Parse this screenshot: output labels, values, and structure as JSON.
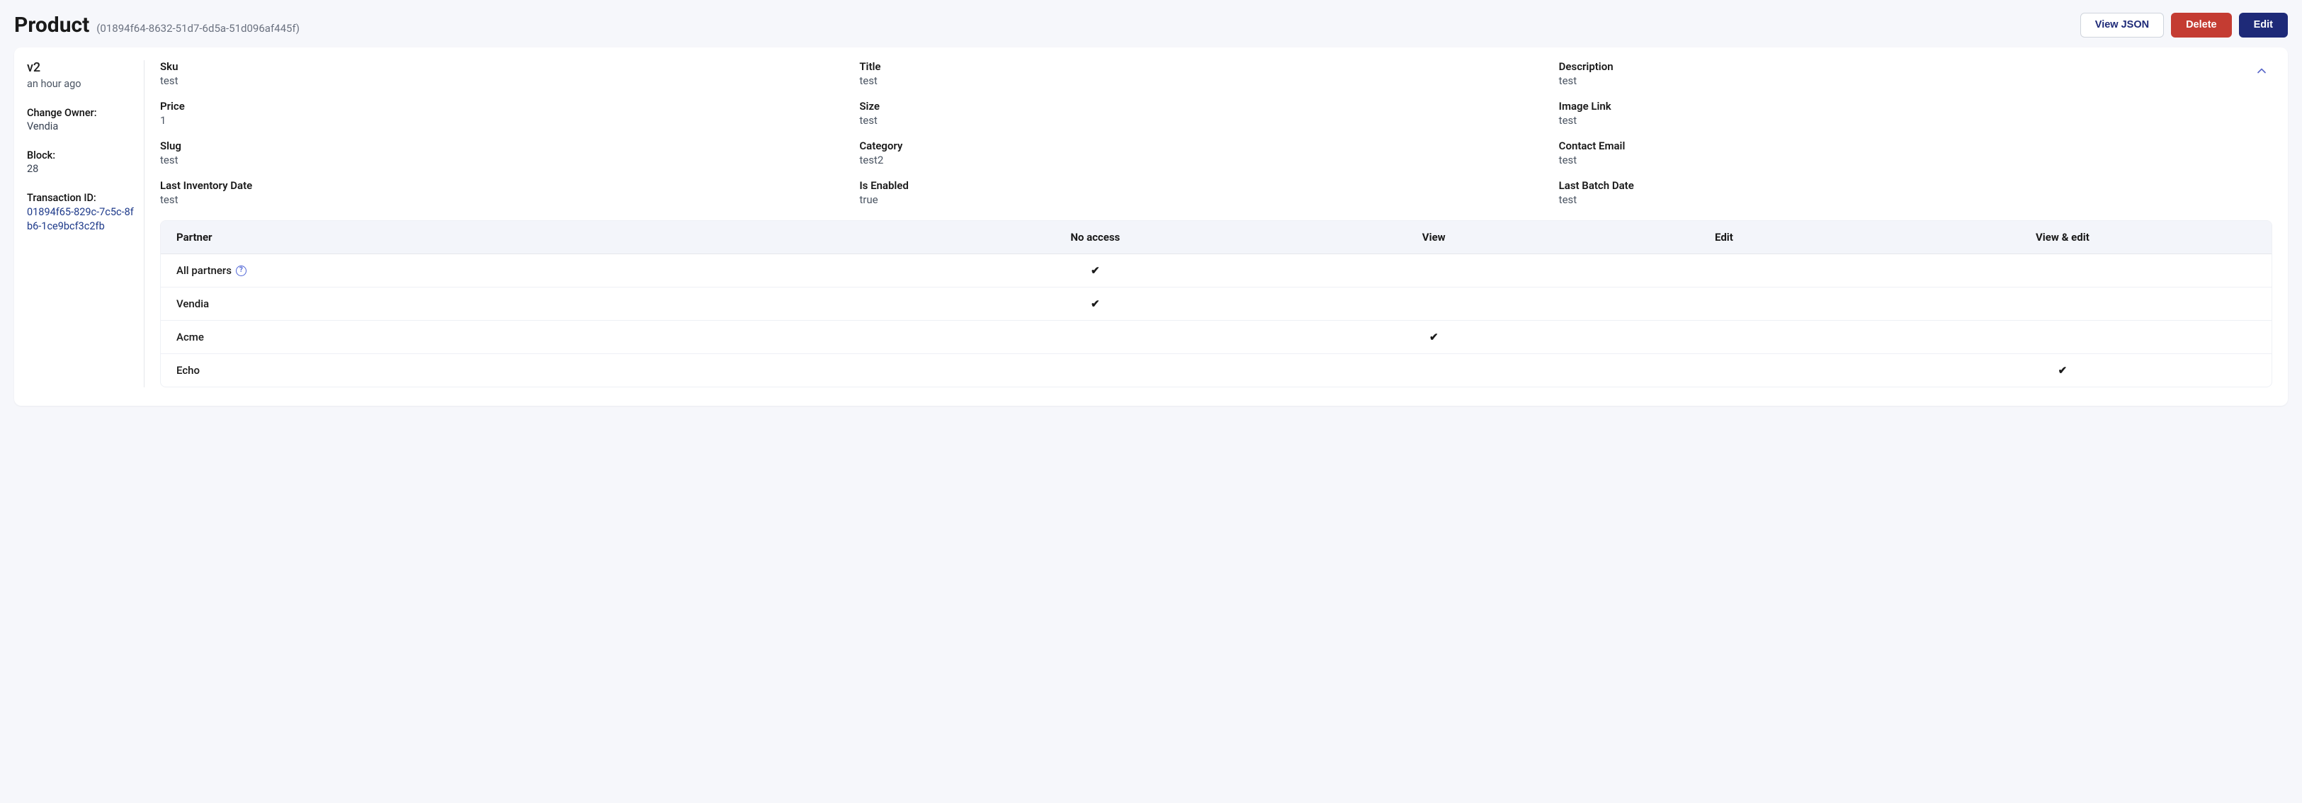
{
  "header": {
    "title": "Product",
    "id_display": "(01894f64-8632-51d7-6d5a-51d096af445f)",
    "actions": {
      "view_json": "View JSON",
      "delete": "Delete",
      "edit": "Edit"
    }
  },
  "meta": {
    "version": "v2",
    "time": "an hour ago",
    "change_owner_label": "Change Owner:",
    "change_owner_value": "Vendia",
    "block_label": "Block:",
    "block_value": "28",
    "txn_label": "Transaction ID:",
    "txn_value": "01894f65-829c-7c5c-8fb6-1ce9bcf3c2fb"
  },
  "fields": {
    "sku": {
      "label": "Sku",
      "value": "test"
    },
    "title": {
      "label": "Title",
      "value": "test"
    },
    "description": {
      "label": "Description",
      "value": "test"
    },
    "price": {
      "label": "Price",
      "value": "1"
    },
    "size": {
      "label": "Size",
      "value": "test"
    },
    "image_link": {
      "label": "Image Link",
      "value": "test"
    },
    "slug": {
      "label": "Slug",
      "value": "test"
    },
    "category": {
      "label": "Category",
      "value": "test2"
    },
    "contact_email": {
      "label": "Contact Email",
      "value": "test"
    },
    "last_inventory": {
      "label": "Last Inventory Date",
      "value": "test"
    },
    "is_enabled": {
      "label": "Is Enabled",
      "value": "true"
    },
    "last_batch": {
      "label": "Last Batch Date",
      "value": "test"
    }
  },
  "permissions": {
    "columns": {
      "partner": "Partner",
      "no_access": "No access",
      "view": "View",
      "edit": "Edit",
      "view_edit": "View & edit"
    },
    "rows": [
      {
        "partner": "All partners",
        "info": true,
        "no_access": "✔",
        "view": "",
        "edit": "",
        "view_edit": ""
      },
      {
        "partner": "Vendia",
        "info": false,
        "no_access": "✔",
        "view": "",
        "edit": "",
        "view_edit": ""
      },
      {
        "partner": "Acme",
        "info": false,
        "no_access": "",
        "view": "✔",
        "edit": "",
        "view_edit": ""
      },
      {
        "partner": "Echo",
        "info": false,
        "no_access": "",
        "view": "",
        "edit": "",
        "view_edit": "✔"
      }
    ]
  }
}
